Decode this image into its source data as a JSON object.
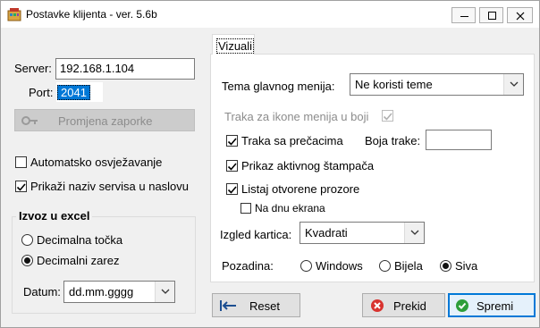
{
  "window": {
    "title": "Postavke klijenta - ver. 5.6b"
  },
  "left": {
    "server_label": "Server:",
    "server_value": "192.168.1.104",
    "port_label": "Port:",
    "port_value": "2041",
    "change_password_label": "Promjena zaporke",
    "auto_refresh_label": "Automatsko osvježavanje",
    "show_service_label": "Prikaži naziv servisa u naslovu"
  },
  "excel": {
    "title": "Izvoz u excel",
    "radio_point": "Decimalna točka",
    "radio_comma": "Decimalni zarez",
    "date_label": "Datum:",
    "date_value": "dd.mm.gggg"
  },
  "visual": {
    "tab_label": "Vizuali",
    "theme_label": "Tema glavnog menija:",
    "theme_value": "Ne koristi teme",
    "icon_strip_label": "Traka za ikone menija u boji",
    "shortcut_strip_label": "Traka sa prečacima",
    "strip_color_label": "Boja trake:",
    "active_printer_label": "Prikaz aktivnog štampača",
    "open_windows_label": "Listaj otvorene prozore",
    "bottom_screen_label": "Na dnu ekrana",
    "cards_label": "Izgled kartica:",
    "cards_value": "Kvadrati",
    "background_label": "Pozadina:",
    "bg_windows": "Windows",
    "bg_white": "Bijela",
    "bg_gray": "Siva"
  },
  "buttons": {
    "reset": "Reset",
    "cancel": "Prekid",
    "save": "Spremi"
  },
  "colors": {
    "accent": "#0078d7",
    "selection": "#0078d7",
    "save_border": "#0078d7"
  }
}
